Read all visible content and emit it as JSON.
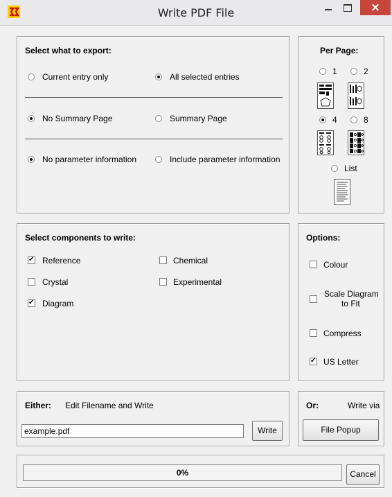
{
  "window": {
    "title": "Write PDF File"
  },
  "export": {
    "heading": "Select what to export:",
    "current_entry_only": "Current entry only",
    "all_selected_entries": "All selected entries",
    "no_summary_page": "No Summary Page",
    "summary_page": "Summary Page",
    "no_parameter_information": "No parameter information",
    "include_parameter_information": "Include parameter information",
    "selected": {
      "entries": "all",
      "summary": "none",
      "parameters": "none"
    }
  },
  "per_page": {
    "heading": "Per Page:",
    "options": [
      "1",
      "2",
      "4",
      "8",
      "List"
    ],
    "selected": "4"
  },
  "components": {
    "heading": "Select components to write:",
    "reference": {
      "label": "Reference",
      "checked": true
    },
    "chemical": {
      "label": "Chemical",
      "checked": false
    },
    "crystal": {
      "label": "Crystal",
      "checked": false
    },
    "experimental": {
      "label": "Experimental",
      "checked": false
    },
    "diagram": {
      "label": "Diagram",
      "checked": true
    }
  },
  "options": {
    "heading": "Options:",
    "colour": {
      "label": "Colour",
      "checked": false
    },
    "scale_diagram_line1": "Scale Diagram",
    "scale_diagram_line2": "to Fit",
    "scale_checked": false,
    "compress": {
      "label": "Compress",
      "checked": false
    },
    "us_letter": {
      "label": "US Letter",
      "checked": true
    }
  },
  "either": {
    "label": "Either:",
    "text": "Edit Filename and Write",
    "filename": "example.pdf",
    "write_button": "Write"
  },
  "or": {
    "label": "Or:",
    "text": "Write via",
    "file_popup_button": "File Popup"
  },
  "progress": {
    "text": "0%",
    "value": 0
  },
  "cancel_button": "Cancel",
  "colors": {
    "close_button": "#c7463a",
    "window_bg": "#f0f0f0"
  }
}
